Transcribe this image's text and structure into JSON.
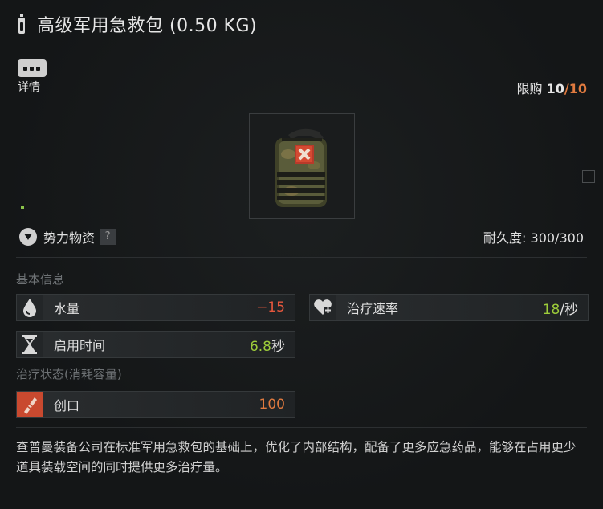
{
  "header": {
    "title": "高级军用急救包 (0.50 KG)",
    "icon": "bottle-icon"
  },
  "details": {
    "label": "详情",
    "icon": "ellipsis-icon"
  },
  "limit": {
    "label": "限购 ",
    "current": "10",
    "sep": "/",
    "max": "10"
  },
  "faction": {
    "label": "势力物资",
    "help": "?",
    "icon": "faction-icon"
  },
  "durability": {
    "label": "耐久度: 300/300"
  },
  "sections": {
    "basic": "基本信息",
    "treatment": "治疗状态(消耗容量)"
  },
  "stats": {
    "water": {
      "label": "水量",
      "value": "−15",
      "icon": "water-drop-icon"
    },
    "heal_rate": {
      "label": "治疗速率",
      "value": "18",
      "unit": "/秒",
      "icon": "heart-plus-icon"
    },
    "use_time": {
      "label": "启用时间",
      "value": "6.8",
      "unit": "秒",
      "icon": "hourglass-icon"
    },
    "wound": {
      "label": "创口",
      "value": "100",
      "icon": "bandage-icon"
    }
  },
  "description": "查普曼装备公司在标准军用急救包的基础上，优化了内部结构，配备了更多应急药品，能够在占用更少道具装载空间的同时提供更多治疗量。",
  "colors": {
    "accent_orange": "#e07a3f",
    "negative_red": "#e5573d",
    "positive_green": "#9dcc3a"
  }
}
